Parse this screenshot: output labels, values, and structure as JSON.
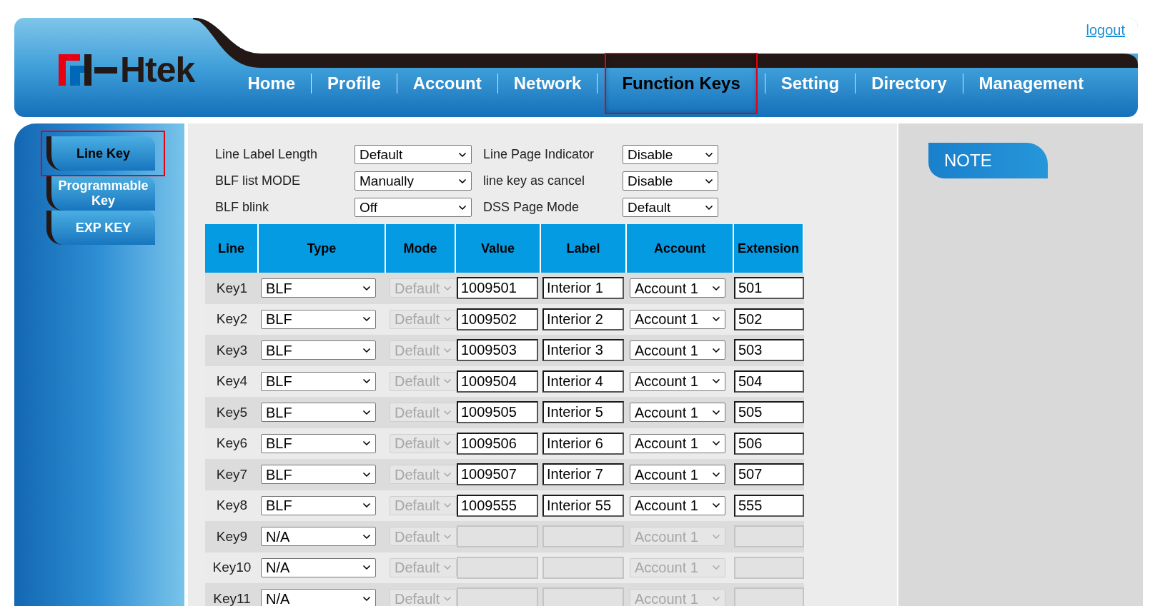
{
  "logo": "Htek",
  "logout": "logout",
  "nav": [
    {
      "label": "Home",
      "selected": false
    },
    {
      "label": "Profile",
      "selected": false
    },
    {
      "label": "Account",
      "selected": false
    },
    {
      "label": "Network",
      "selected": false
    },
    {
      "label": "Function Keys",
      "selected": true
    },
    {
      "label": "Setting",
      "selected": false
    },
    {
      "label": "Directory",
      "selected": false
    },
    {
      "label": "Management",
      "selected": false
    }
  ],
  "sidebar": {
    "items": [
      {
        "label": "Line Key",
        "selected": true
      },
      {
        "label": "Programmable Key",
        "selected": false
      },
      {
        "label": "EXP KEY",
        "selected": false
      }
    ]
  },
  "settings": [
    {
      "label": "Line Label Length",
      "value": "Default"
    },
    {
      "label": "Line Page Indicator",
      "value": "Disable"
    },
    {
      "label": "BLF list MODE",
      "value": "Manually"
    },
    {
      "label": "line key as cancel",
      "value": "Disable"
    },
    {
      "label": "BLF blink",
      "value": "Off"
    },
    {
      "label": "DSS Page Mode",
      "value": "Default"
    }
  ],
  "table": {
    "columns": [
      "Line",
      "Type",
      "Mode",
      "Value",
      "Label",
      "Account",
      "Extension"
    ],
    "rows": [
      {
        "line": "Key1",
        "type": "BLF",
        "mode": "Default",
        "mode_disabled": true,
        "value": "1009501",
        "label": "Interior 1",
        "account": "Account 1",
        "extension": "501",
        "disabled": false
      },
      {
        "line": "Key2",
        "type": "BLF",
        "mode": "Default",
        "mode_disabled": true,
        "value": "1009502",
        "label": "Interior 2",
        "account": "Account 1",
        "extension": "502",
        "disabled": false
      },
      {
        "line": "Key3",
        "type": "BLF",
        "mode": "Default",
        "mode_disabled": true,
        "value": "1009503",
        "label": "Interior 3",
        "account": "Account 1",
        "extension": "503",
        "disabled": false
      },
      {
        "line": "Key4",
        "type": "BLF",
        "mode": "Default",
        "mode_disabled": true,
        "value": "1009504",
        "label": "Interior 4",
        "account": "Account 1",
        "extension": "504",
        "disabled": false
      },
      {
        "line": "Key5",
        "type": "BLF",
        "mode": "Default",
        "mode_disabled": true,
        "value": "1009505",
        "label": "Interior 5",
        "account": "Account 1",
        "extension": "505",
        "disabled": false
      },
      {
        "line": "Key6",
        "type": "BLF",
        "mode": "Default",
        "mode_disabled": true,
        "value": "1009506",
        "label": "Interior 6",
        "account": "Account 1",
        "extension": "506",
        "disabled": false
      },
      {
        "line": "Key7",
        "type": "BLF",
        "mode": "Default",
        "mode_disabled": true,
        "value": "1009507",
        "label": "Interior 7",
        "account": "Account 1",
        "extension": "507",
        "disabled": false
      },
      {
        "line": "Key8",
        "type": "BLF",
        "mode": "Default",
        "mode_disabled": true,
        "value": "1009555",
        "label": "Interior 55",
        "account": "Account 1",
        "extension": "555",
        "disabled": false
      },
      {
        "line": "Key9",
        "type": "N/A",
        "mode": "Default",
        "mode_disabled": true,
        "account": "Account 1",
        "disabled": true
      },
      {
        "line": "Key10",
        "type": "N/A",
        "mode": "Default",
        "mode_disabled": true,
        "account": "Account 1",
        "disabled": true
      },
      {
        "line": "Key11",
        "type": "N/A",
        "mode": "Default",
        "mode_disabled": true,
        "account": "Account 1",
        "disabled": true
      }
    ]
  },
  "note": {
    "title": "NOTE"
  }
}
